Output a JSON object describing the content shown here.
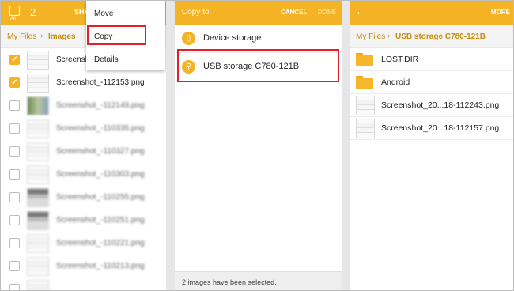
{
  "panel1": {
    "select_all_label": "All",
    "selected_count": "2",
    "share_label": "SHA",
    "breadcrumb": [
      "My Files",
      "Images"
    ],
    "menu": [
      "Move",
      "Copy",
      "Details"
    ],
    "files": [
      {
        "name": "Screensh",
        "checked": true,
        "blurred": false
      },
      {
        "name": "Screenshot_-112153.png",
        "checked": true,
        "blurred": false
      },
      {
        "name": "Screenshot_-112149.png",
        "checked": false,
        "blurred": true
      },
      {
        "name": "Screenshot_-110335.png",
        "checked": false,
        "blurred": true
      },
      {
        "name": "Screenshot_-110327.png",
        "checked": false,
        "blurred": true
      },
      {
        "name": "Screenshot_-110303.png",
        "checked": false,
        "blurred": true
      },
      {
        "name": "Screenshot_-110255.png",
        "checked": false,
        "blurred": true
      },
      {
        "name": "Screenshot_-110251.png",
        "checked": false,
        "blurred": true
      },
      {
        "name": "Screenshot_-110221.png",
        "checked": false,
        "blurred": true
      },
      {
        "name": "Screenshot_-110213.png",
        "checked": false,
        "blurred": true
      }
    ]
  },
  "panel2": {
    "title": "Copy to",
    "cancel": "CANCEL",
    "done": "DONE",
    "storage": [
      {
        "label": "Device storage",
        "icon": "phone-icon"
      },
      {
        "label": "USB storage C780-121B",
        "icon": "usb-icon"
      }
    ],
    "status": "2 images have been selected."
  },
  "panel3": {
    "more": "MORE",
    "breadcrumb": [
      "My Files",
      "USB storage C780-121B"
    ],
    "items": [
      {
        "name": "LOST.DIR",
        "type": "folder"
      },
      {
        "name": "Android",
        "type": "folder"
      },
      {
        "name": "Screenshot_20...18-112243.png",
        "type": "image"
      },
      {
        "name": "Screenshot_20...18-112157.png",
        "type": "image"
      }
    ]
  },
  "colors": {
    "accent": "#f3b324",
    "highlight": "#e0202a"
  }
}
